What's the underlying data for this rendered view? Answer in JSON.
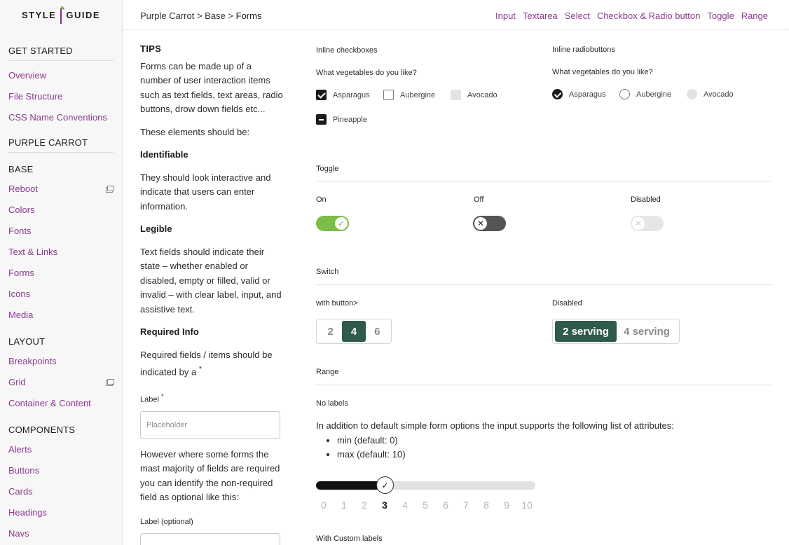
{
  "logo": {
    "left": "STYLE",
    "right": "GUIDE"
  },
  "sidebar": {
    "get_started": "GET STARTED",
    "get_started_items": [
      "Overview",
      "File Structure",
      "CSS Name Conventions"
    ],
    "purple_carrot": "PURPLE CARROT",
    "base": "BASE",
    "base_items": [
      "Reboot",
      "Colors",
      "Fonts",
      "Text & Links",
      "Forms",
      "Icons",
      "Media"
    ],
    "layout": "LAYOUT",
    "layout_items": [
      "Breakpoints",
      "Grid",
      "Container & Content"
    ],
    "components": "COMPONENTS",
    "component_items": [
      "Alerts",
      "Buttons",
      "Cards",
      "Headings",
      "Navs"
    ]
  },
  "header": {
    "crumb1": "Purple Carrot",
    "crumb2": "Base",
    "crumb3": "Forms",
    "sep": ">",
    "links": [
      "Input",
      "Textarea",
      "Select",
      "Checkbox & Radio button",
      "Toggle",
      "Range"
    ]
  },
  "tips": {
    "title": "TIPS",
    "intro": "Forms can be made up of a number of user interaction items such as text fields, text areas, radio buttons, drow down fields etc...",
    "should_be": "These elements should be:",
    "identifiable": "Identifiable",
    "identifiable_text": "They should look interactive and indicate that users can enter information.",
    "legible": "Legible",
    "legible_text": "Text fields should indicate their state – whether enabled or disabled, empty or filled, valid or invalid – with clear label, input, and assistive text.",
    "required": "Required Info",
    "required_text": "Required fields / items should be indicated by a",
    "asterisk": "*",
    "label1": "Label",
    "placeholder": "Placeholder",
    "optional_text": "However where some forms the mast majority of fields are required you can identify the non-required field as optional like this:",
    "label2": "Label",
    "optional": "(optional)"
  },
  "checkboxes": {
    "title": "Inline checkboxes",
    "question": "What vegetables do you like?",
    "items": [
      "Asparagus",
      "Aubergine",
      "Avocado",
      "Pineapple"
    ]
  },
  "radios": {
    "title": "Inline radiobuttons",
    "question": "What vegetables do you like?",
    "items": [
      "Asparagus",
      "Aubergine",
      "Avocado"
    ]
  },
  "toggle": {
    "title": "Toggle",
    "on": "On",
    "off": "Off",
    "disabled": "Disabled",
    "check_glyph": "✓",
    "x_glyph": "✕"
  },
  "switch": {
    "title": "Switch",
    "with_button": "with button>",
    "disabled": "Disabled",
    "opts": [
      "2",
      "4",
      "6"
    ],
    "serving": [
      "2 serving",
      "4 serving"
    ]
  },
  "range": {
    "title": "Range",
    "no_labels": "No labels",
    "desc": "In addition to default simple form options the input supports the following list of attributes:",
    "attrs": [
      "min (default: 0)",
      "max (default: 10)"
    ],
    "value": 3,
    "min": 0,
    "max": 10,
    "ticks": [
      "0",
      "1",
      "2",
      "3",
      "4",
      "5",
      "6",
      "7",
      "8",
      "9",
      "10"
    ],
    "custom_labels": "With Custom labels",
    "thumb_glyph": "✓"
  },
  "colors": {
    "accent": "#8a3a8f",
    "toggle_on": "#7bbd48",
    "switch_active": "#2f5a4e"
  }
}
